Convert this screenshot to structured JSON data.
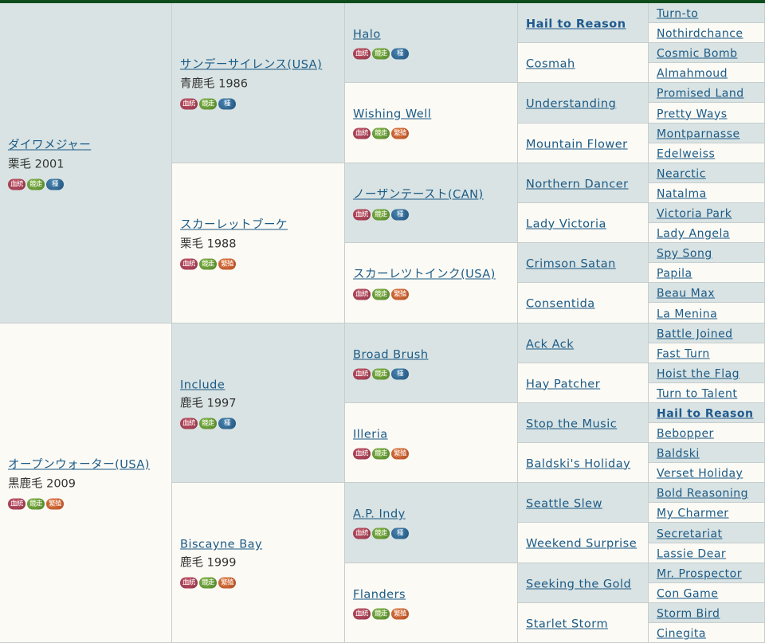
{
  "badge_labels": {
    "pedigree": "血統",
    "race": "競走",
    "stud": "種",
    "breed": "繁殖"
  },
  "gen1": [
    {
      "name": "ダイワメジャー",
      "info": "栗毛  2001",
      "third": "stud"
    },
    {
      "name": "オープンウォーター(USA)",
      "info": "黒鹿毛  2009",
      "third": "breed"
    }
  ],
  "gen2": [
    {
      "name": "サンデーサイレンス(USA)",
      "info": "青鹿毛  1986",
      "third": "stud"
    },
    {
      "name": "スカーレットブーケ",
      "info": "栗毛  1988",
      "third": "breed"
    },
    {
      "name": "Include",
      "info": "鹿毛  1997",
      "third": "stud"
    },
    {
      "name": "Biscayne Bay",
      "info": "鹿毛  1999",
      "third": "breed"
    }
  ],
  "gen3": [
    {
      "name": "Halo",
      "third": "stud"
    },
    {
      "name": "Wishing Well",
      "third": "breed"
    },
    {
      "name": "ノーザンテースト(CAN)",
      "third": "stud"
    },
    {
      "name": "スカーレツトインク(USA)",
      "third": "breed"
    },
    {
      "name": "Broad Brush",
      "third": "stud"
    },
    {
      "name": "Illeria",
      "third": "breed"
    },
    {
      "name": "A.P. Indy",
      "third": "stud"
    },
    {
      "name": "Flanders",
      "third": "breed"
    }
  ],
  "gen4": [
    {
      "name": "Hail to Reason",
      "bold": true
    },
    {
      "name": "Cosmah"
    },
    {
      "name": "Understanding"
    },
    {
      "name": "Mountain Flower"
    },
    {
      "name": "Northern Dancer"
    },
    {
      "name": "Lady Victoria"
    },
    {
      "name": "Crimson Satan"
    },
    {
      "name": "Consentida"
    },
    {
      "name": "Ack Ack"
    },
    {
      "name": "Hay Patcher"
    },
    {
      "name": "Stop the Music"
    },
    {
      "name": "Baldski's Holiday"
    },
    {
      "name": "Seattle Slew"
    },
    {
      "name": "Weekend Surprise"
    },
    {
      "name": "Seeking the Gold"
    },
    {
      "name": "Starlet Storm"
    }
  ],
  "gen5": [
    {
      "name": "Turn-to"
    },
    {
      "name": "Nothirdchance"
    },
    {
      "name": "Cosmic Bomb"
    },
    {
      "name": "Almahmoud"
    },
    {
      "name": "Promised Land"
    },
    {
      "name": "Pretty Ways"
    },
    {
      "name": "Montparnasse"
    },
    {
      "name": "Edelweiss"
    },
    {
      "name": "Nearctic"
    },
    {
      "name": "Natalma"
    },
    {
      "name": "Victoria Park"
    },
    {
      "name": "Lady Angela"
    },
    {
      "name": "Spy Song"
    },
    {
      "name": "Papila"
    },
    {
      "name": "Beau Max"
    },
    {
      "name": "La Menina"
    },
    {
      "name": "Battle Joined"
    },
    {
      "name": "Fast Turn"
    },
    {
      "name": "Hoist the Flag"
    },
    {
      "name": "Turn to Talent"
    },
    {
      "name": "Hail to Reason",
      "bold": true
    },
    {
      "name": "Bebopper"
    },
    {
      "name": "Baldski"
    },
    {
      "name": "Verset Holiday"
    },
    {
      "name": "Bold Reasoning"
    },
    {
      "name": "My Charmer"
    },
    {
      "name": "Secretariat"
    },
    {
      "name": "Lassie Dear"
    },
    {
      "name": "Mr. Prospector"
    },
    {
      "name": "Con Game"
    },
    {
      "name": "Storm Bird"
    },
    {
      "name": "Cinegita"
    }
  ],
  "colors": {
    "topbar": "#0d4d1d",
    "cell_a": "#d9e3e3",
    "cell_b": "#fcfaf5",
    "link": "#1a5a86"
  }
}
